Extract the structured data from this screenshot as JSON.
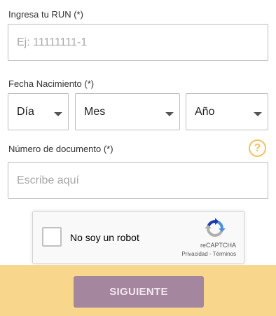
{
  "run": {
    "label": "Ingresa tu RUN (*)",
    "placeholder": "Ej: 11111111-1",
    "value": ""
  },
  "birthdate": {
    "label": "Fecha Nacimiento (*)",
    "day": "Día",
    "month": "Mes",
    "year": "Año"
  },
  "document": {
    "label": "Número de documento (*)",
    "placeholder": "Escribe aquí",
    "value": "",
    "help_icon": "?"
  },
  "recaptcha": {
    "checkbox_label": "No soy un robot",
    "brand": "reCAPTCHA",
    "links": "Privacidad - Términos",
    "checked": false
  },
  "footer": {
    "next_label": "SIGUIENTE"
  },
  "colors": {
    "accent_bar": "#f8d68c",
    "button": "#a4869f",
    "help_icon": "#f2c45c"
  }
}
